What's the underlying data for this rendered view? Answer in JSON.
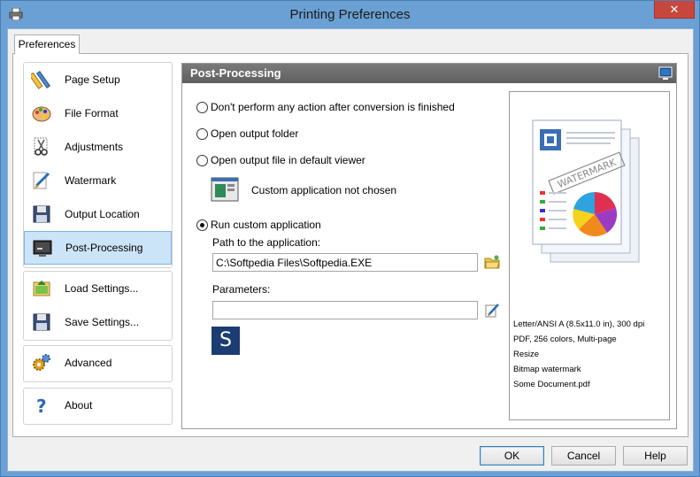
{
  "window": {
    "title": "Printing Preferences",
    "close_glyph": "✕"
  },
  "tabs": [
    {
      "label": "Preferences"
    }
  ],
  "nav": {
    "items": [
      {
        "label": "Page Setup",
        "icon": "ruler-pencil-icon"
      },
      {
        "label": "File Format",
        "icon": "palette-icon"
      },
      {
        "label": "Adjustments",
        "icon": "scissors-icon"
      },
      {
        "label": "Watermark",
        "icon": "watermark-pen-icon"
      },
      {
        "label": "Output Location",
        "icon": "floppy-disk-icon"
      },
      {
        "label": "Post-Processing",
        "icon": "monitor-icon",
        "selected": true
      }
    ],
    "settings_items": [
      {
        "label": "Load Settings...",
        "icon": "load-settings-icon"
      },
      {
        "label": "Save Settings...",
        "icon": "save-settings-icon"
      }
    ],
    "advanced_label": "Advanced",
    "about_label": "About"
  },
  "panel": {
    "title": "Post-Processing",
    "options": {
      "no_action": "Don't perform any action after conversion is finished",
      "open_folder": "Open output folder",
      "open_viewer": "Open output file in default viewer",
      "custom_app": "Run custom application"
    },
    "selected_option": "custom_app",
    "custom_app_status": "Custom application not chosen",
    "path_label": "Path to the application:",
    "path_value": "C:\\Softpedia Files\\Softpedia.EXE",
    "parameters_label": "Parameters:",
    "parameters_value": "",
    "app_logo_letter": "S"
  },
  "preview": {
    "watermark_text": "WATERMARK",
    "info": [
      "Letter/ANSI A (8.5x11.0 in), 300 dpi",
      "PDF, 256 colors, Multi-page",
      "Resize",
      "Bitmap watermark",
      "Some Document.pdf"
    ]
  },
  "buttons": {
    "ok": "OK",
    "cancel": "Cancel",
    "help": "Help"
  }
}
